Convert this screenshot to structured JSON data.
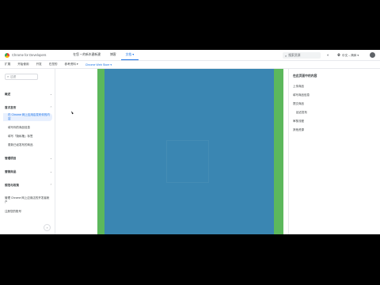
{
  "header": {
    "brand": "Chrome for Developers",
    "nav": [
      {
        "label": "在您 + 的新木建新建",
        "active": false
      },
      {
        "label": "博客",
        "active": false
      },
      {
        "label": "文档 ▾",
        "active": true
      }
    ],
    "search_placeholder": "搜索资源",
    "language": "中文 – 简体 ▾"
  },
  "subnav": {
    "items": [
      {
        "label": "扩展",
        "active": false
      },
      {
        "label": "开始使用",
        "active": false
      },
      {
        "label": "开发",
        "active": false
      },
      {
        "label": "在您的",
        "active": false
      },
      {
        "label": "参考资料 ▾",
        "active": false
      },
      {
        "label": "Chrome Web Store ▾",
        "active": true
      }
    ]
  },
  "sidebar": {
    "filter_placeholder": "过滤",
    "sections": [
      {
        "label": "概述",
        "chev": "⌄"
      },
      {
        "label": "首次发布",
        "chev": "⌃"
      }
    ],
    "items": [
      {
        "label": "在 Chrome 网上应用店发布你的内容",
        "active": true
      },
      {
        "label": "填写你的商品信息",
        "active": false
      },
      {
        "label": "填写「隐私権」标签",
        "active": false
      },
      {
        "label": "更新已经发布的商品",
        "active": false
      }
    ],
    "sections2": [
      {
        "label": "管理项目",
        "chev": "⌄"
      },
      {
        "label": "营销商品",
        "chev": "⌄"
      },
      {
        "label": "规范与政策",
        "chev": "⌃"
      }
    ],
    "links": [
      {
        "label": "管理 Chrome 网上应用店的开发者帐户"
      },
      {
        "label": "注册您的账号"
      }
    ],
    "collapse_icon": "‹"
  },
  "toc": {
    "title": "在此页面中的内容",
    "items": [
      {
        "label": "上传商品",
        "sub": false
      },
      {
        "label": "填写商品信息",
        "sub": false
      },
      {
        "label": "提交商品",
        "sub": false
      },
      {
        "label": "延迟发布",
        "sub": true
      },
      {
        "label": "审核流程",
        "sub": false
      },
      {
        "label": "其他资源",
        "sub": false
      }
    ]
  },
  "colors": {
    "video_border": "#5cb85c",
    "video_fill": "#3a86b2",
    "accent": "#1a73e8"
  }
}
